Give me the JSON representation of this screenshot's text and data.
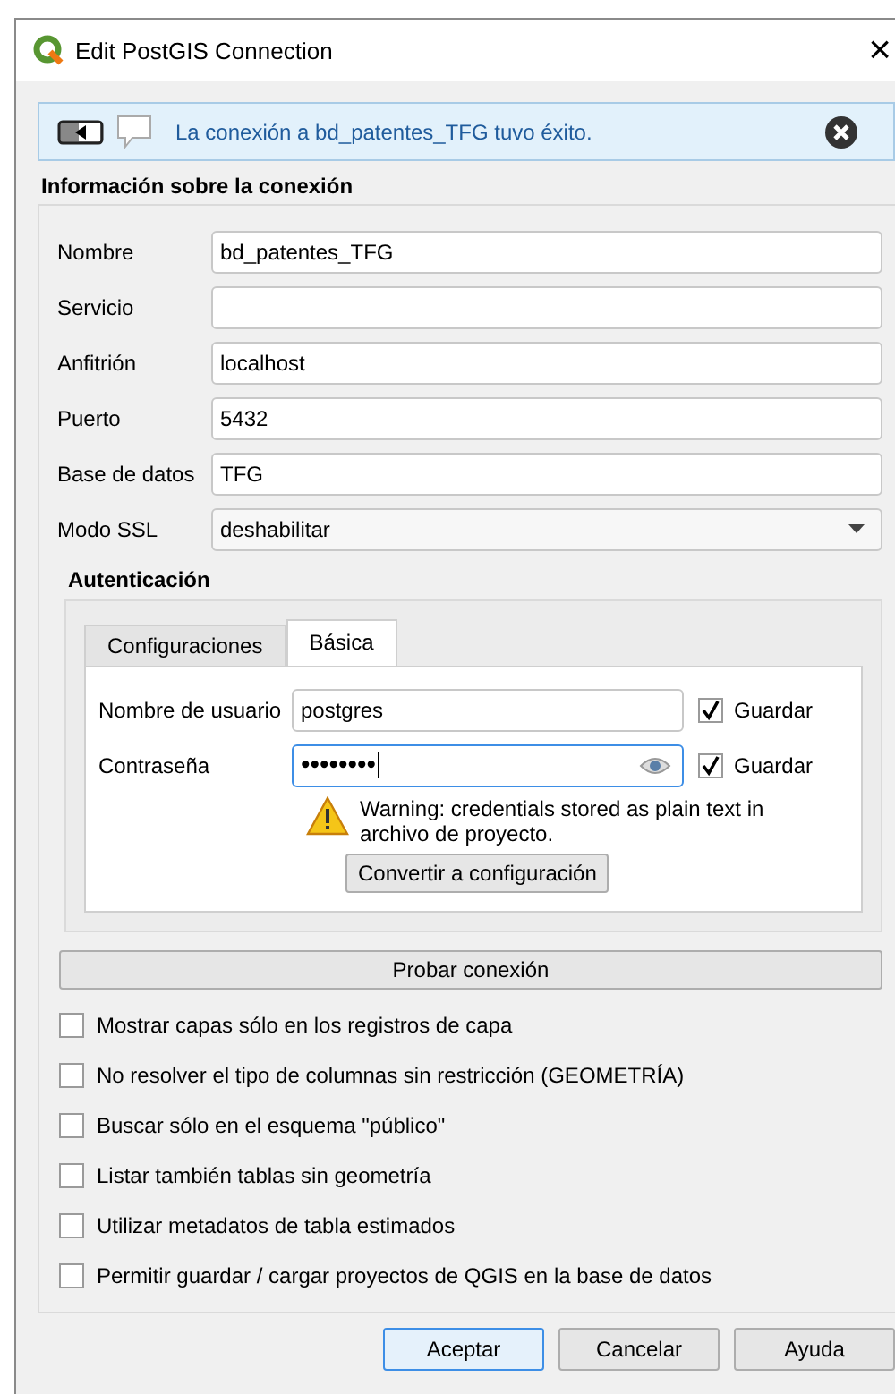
{
  "window": {
    "title": "Edit PostGIS Connection",
    "close": "×"
  },
  "message": {
    "text": "La conexión a bd_patentes_TFG tuvo éxito."
  },
  "connection": {
    "heading": "Información sobre la conexión",
    "fields": [
      {
        "label": "Nombre",
        "value": "bd_patentes_TFG",
        "kind": "text"
      },
      {
        "label": "Servicio",
        "kind": "text"
      },
      {
        "label": "Anfitrión",
        "value": "localhost",
        "kind": "text"
      },
      {
        "label": "Puerto",
        "value": "5432",
        "kind": "text"
      },
      {
        "label": "Base de datos",
        "value": "TFG",
        "kind": "text"
      },
      {
        "label": "Modo SSL",
        "value": "deshabilitar",
        "kind": "select"
      }
    ]
  },
  "auth": {
    "heading": "Autenticación",
    "tabs": [
      {
        "label": "Configuraciones",
        "selected": false
      },
      {
        "label": "Básica",
        "selected": true
      }
    ],
    "username": {
      "label": "Nombre de usuario",
      "value": "postgres",
      "save_label": "Guardar",
      "save_checked": true
    },
    "password": {
      "label": "Contraseña",
      "value": "••••••••",
      "save_label": "Guardar",
      "save_checked": true
    },
    "warning": "Warning: credentials stored as plain text in archivo de proyecto.",
    "convert_button": "Convertir a configuración"
  },
  "test_button": "Probar conexión",
  "options": [
    {
      "label": "Mostrar capas sólo en los registros de capa",
      "checked": false
    },
    {
      "label": "No resolver el tipo de columnas sin restricción (GEOMETRÍA)",
      "checked": false
    },
    {
      "label": "Buscar sólo en el esquema \"público\"",
      "checked": false
    },
    {
      "label": "Listar también tablas sin geometría",
      "checked": false
    },
    {
      "label": "Utilizar metadatos de tabla estimados",
      "checked": false
    },
    {
      "label": "Permitir guardar / cargar proyectos de QGIS en la base de datos",
      "checked": false
    }
  ],
  "buttons": [
    {
      "label": "Aceptar",
      "default": true
    },
    {
      "label": "Cancelar",
      "default": false
    },
    {
      "label": "Ayuda",
      "default": false
    }
  ]
}
